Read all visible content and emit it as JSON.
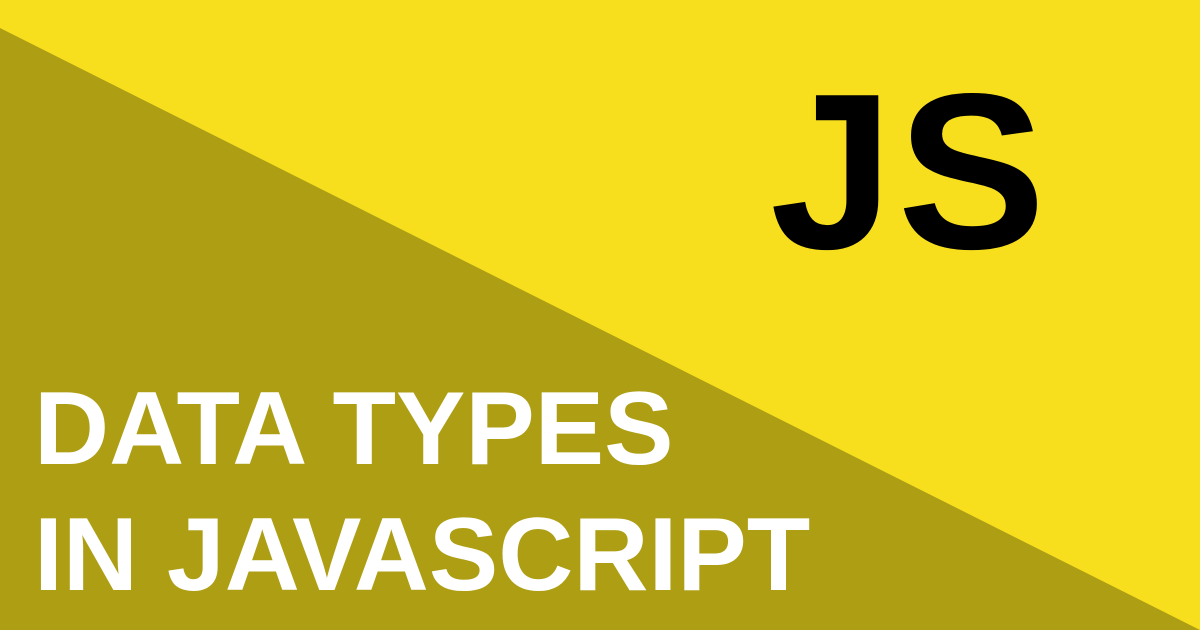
{
  "colors": {
    "light_yellow": "#F7DF1E",
    "dark_olive": "#AE9E14",
    "logo_text": "#000000",
    "headline_text": "#FFFFFF"
  },
  "logo": {
    "text": "JS"
  },
  "headline": {
    "line1": "DATA TYPES",
    "line2": "IN JAVASCRIPT"
  }
}
